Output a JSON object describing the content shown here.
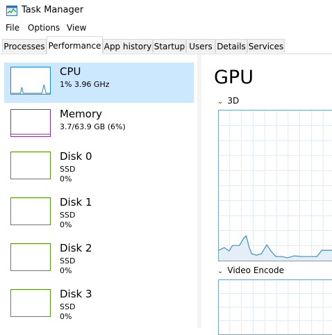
{
  "window": {
    "title": "Task Manager"
  },
  "menu": [
    "File",
    "Options",
    "View"
  ],
  "tabs": [
    "Processes",
    "Performance",
    "App history",
    "Startup",
    "Users",
    "Details",
    "Services"
  ],
  "resources": [
    {
      "name": "CPU",
      "line1": "1%  3.96 GHz",
      "line2": ""
    },
    {
      "name": "Memory",
      "line1": "3.7/63.9 GB (6%)",
      "line2": ""
    },
    {
      "name": "Disk 0",
      "line1": "SSD",
      "line2": "0%"
    },
    {
      "name": "Disk 1",
      "line1": "SSD",
      "line2": "0%"
    },
    {
      "name": "Disk 2",
      "line1": "SSD",
      "line2": "0%"
    },
    {
      "name": "Disk 3",
      "line1": "SSD",
      "line2": "0%"
    }
  ],
  "gpu": {
    "title": "GPU",
    "section_3d": "3D",
    "section_video_encode": "Video Encode"
  },
  "colors": {
    "cpu": "#1a86c8",
    "memory": "#8b2fa0",
    "disk": "#4d9a06",
    "gpu": "#6ea0c8",
    "selected": "#cce8ff"
  }
}
